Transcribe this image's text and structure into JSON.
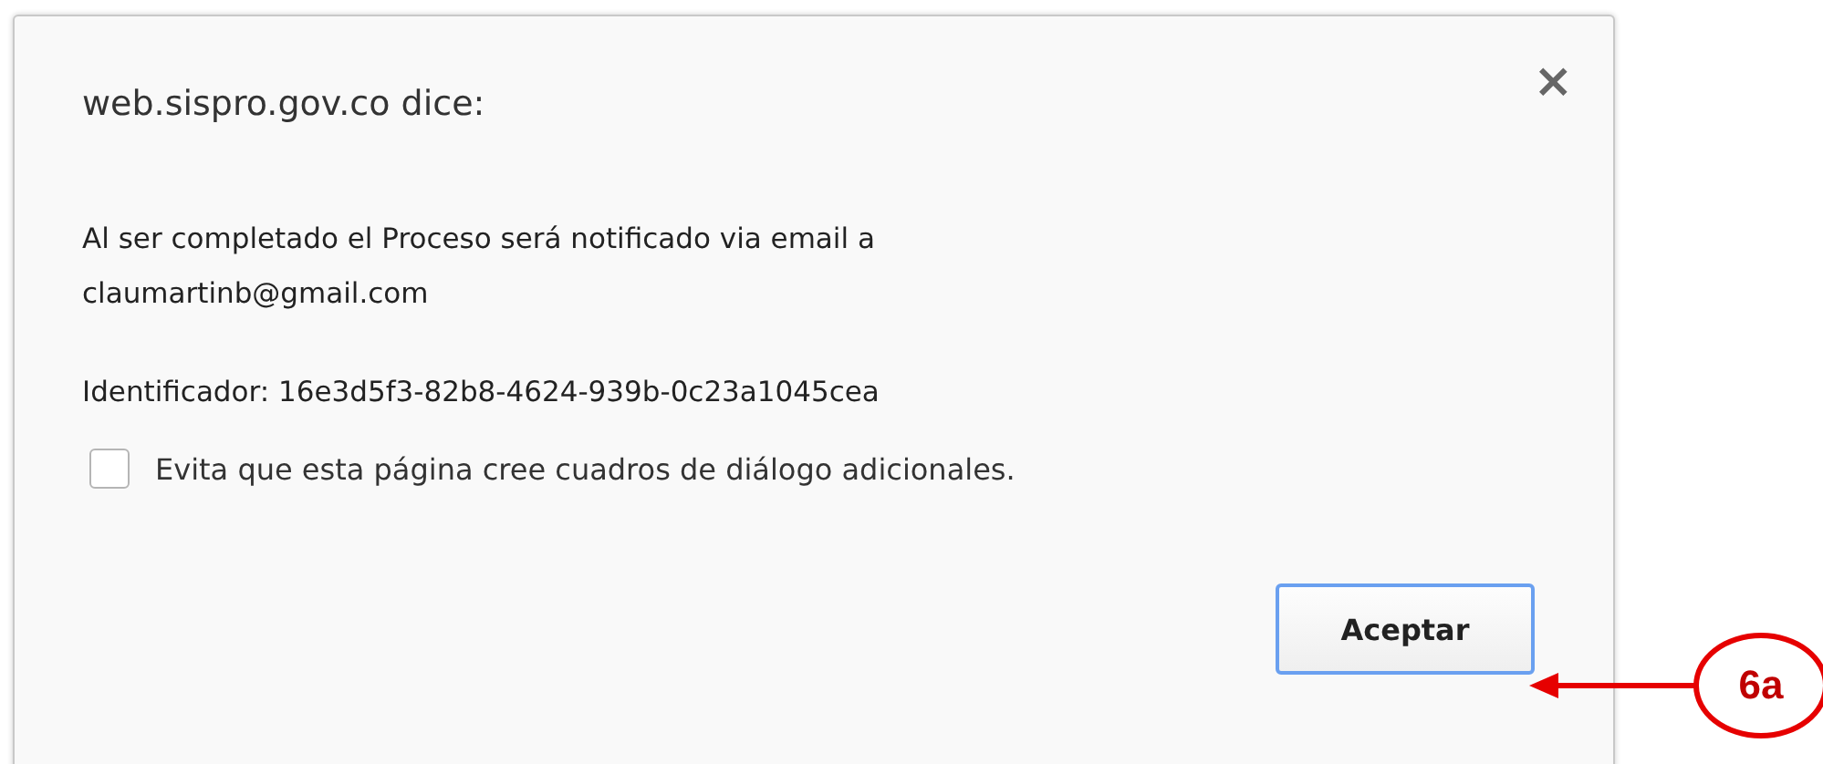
{
  "dialog": {
    "title": "web.sispro.gov.co dice:",
    "message_lines": [
      "Al ser completado el Proceso será notificado via email a",
      "claumartinb@gmail.com"
    ],
    "identifier": "Identificador: 16e3d5f3-82b8-4624-939b-0c23a1045cea",
    "checkbox": {
      "label": "Evita que esta página cree cuadros de diálogo adicionales.",
      "checked": false
    },
    "close": "×",
    "buttons": [
      {
        "label": "Aceptar",
        "focused": true
      }
    ]
  },
  "annotation": {
    "label": "6a"
  }
}
